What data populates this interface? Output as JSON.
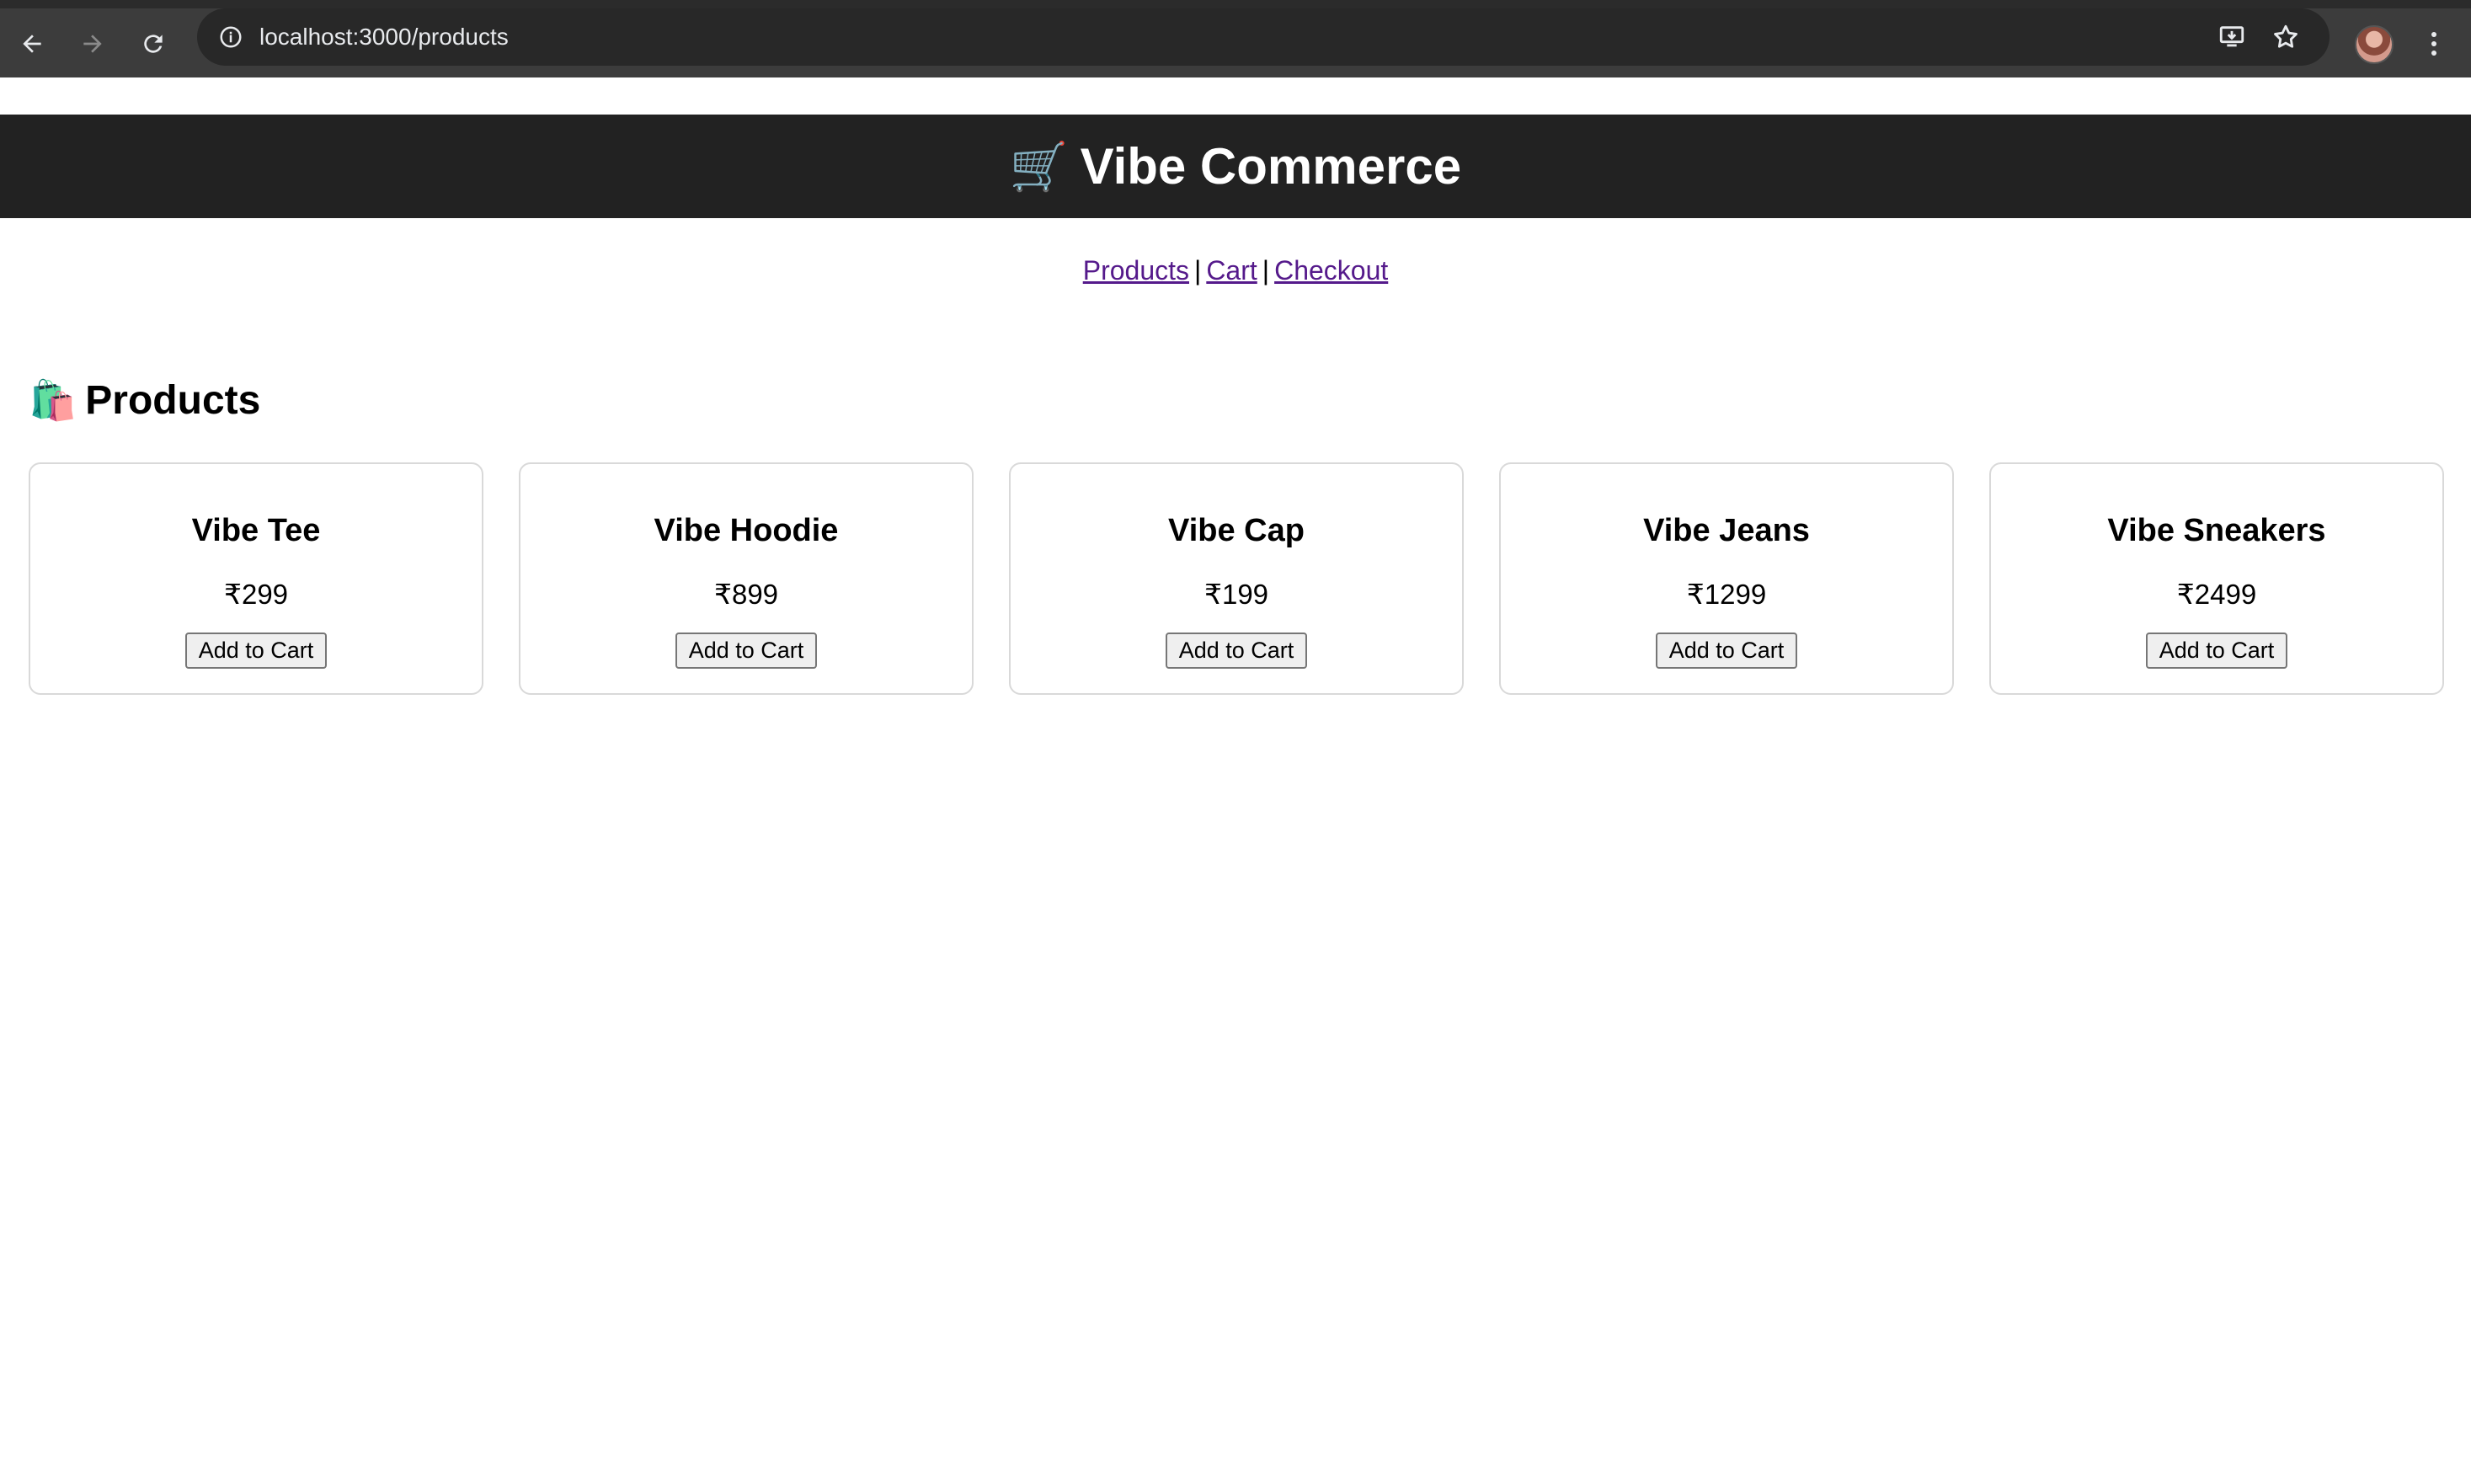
{
  "browser": {
    "url": "localhost:3000/products"
  },
  "header": {
    "title": "Vibe Commerce",
    "icon": "shopping-cart-emoji"
  },
  "nav": {
    "links": [
      "Products",
      "Cart",
      "Checkout"
    ],
    "separator": "|"
  },
  "products_section": {
    "title": "Products",
    "icon": "shopping-bags-emoji"
  },
  "products": [
    {
      "name": "Vibe Tee",
      "price": "₹299",
      "button": "Add to Cart"
    },
    {
      "name": "Vibe Hoodie",
      "price": "₹899",
      "button": "Add to Cart"
    },
    {
      "name": "Vibe Cap",
      "price": "₹199",
      "button": "Add to Cart"
    },
    {
      "name": "Vibe Jeans",
      "price": "₹1299",
      "button": "Add to Cart"
    },
    {
      "name": "Vibe Sneakers",
      "price": "₹2499",
      "button": "Add to Cart"
    }
  ],
  "colors": {
    "header_bg": "#222222",
    "link": "#551a8b",
    "chrome_bg": "#3c3c3c"
  }
}
